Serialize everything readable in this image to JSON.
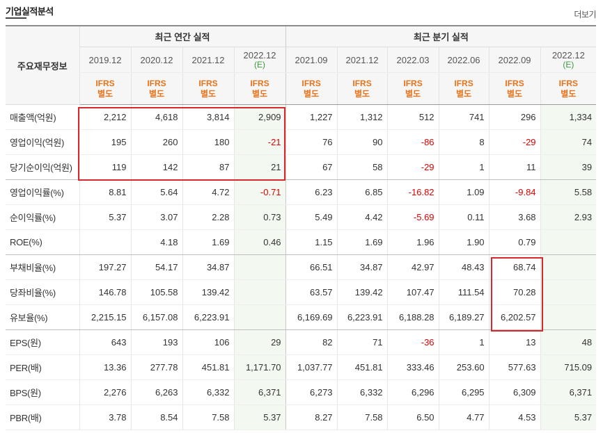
{
  "page": {
    "title": "기업실적분석",
    "more_label": "더보기"
  },
  "table": {
    "label_header": "주요재무정보",
    "group_annual": "최근 연간 실적",
    "group_quarterly": "최근 분기 실적",
    "columns": [
      {
        "date": "2019.12",
        "estimate": "",
        "basis": "IFRS",
        "scope": "별도"
      },
      {
        "date": "2020.12",
        "estimate": "",
        "basis": "IFRS",
        "scope": "별도"
      },
      {
        "date": "2021.12",
        "estimate": "",
        "basis": "IFRS",
        "scope": "별도"
      },
      {
        "date": "2022.12",
        "estimate": "(E)",
        "basis": "IFRS",
        "scope": "별도"
      },
      {
        "date": "2021.09",
        "estimate": "",
        "basis": "IFRS",
        "scope": "별도"
      },
      {
        "date": "2021.12",
        "estimate": "",
        "basis": "IFRS",
        "scope": "별도"
      },
      {
        "date": "2022.03",
        "estimate": "",
        "basis": "IFRS",
        "scope": "별도"
      },
      {
        "date": "2022.06",
        "estimate": "",
        "basis": "IFRS",
        "scope": "별도"
      },
      {
        "date": "2022.09",
        "estimate": "",
        "basis": "IFRS",
        "scope": "별도"
      },
      {
        "date": "2022.12",
        "estimate": "(E)",
        "basis": "IFRS",
        "scope": "별도"
      }
    ],
    "rows": [
      {
        "label": "매출액(억원)",
        "values": [
          "2,212",
          "4,618",
          "3,814",
          "2,909",
          "1,227",
          "1,312",
          "512",
          "741",
          "296",
          "1,334"
        ]
      },
      {
        "label": "영업이익(억원)",
        "values": [
          "195",
          "260",
          "180",
          "-21",
          "76",
          "90",
          "-86",
          "8",
          "-29",
          "74"
        ]
      },
      {
        "label": "당기순이익(억원)",
        "values": [
          "119",
          "142",
          "87",
          "21",
          "67",
          "58",
          "-29",
          "1",
          "11",
          "39"
        ]
      },
      {
        "label": "영업이익률(%)",
        "values": [
          "8.81",
          "5.64",
          "4.72",
          "-0.71",
          "6.23",
          "6.85",
          "-16.82",
          "1.09",
          "-9.84",
          "5.58"
        ]
      },
      {
        "label": "순이익률(%)",
        "values": [
          "5.37",
          "3.07",
          "2.28",
          "0.73",
          "5.49",
          "4.42",
          "-5.69",
          "0.11",
          "3.68",
          "2.93"
        ]
      },
      {
        "label": "ROE(%)",
        "values": [
          "",
          "4.18",
          "1.69",
          "0.46",
          "1.15",
          "1.69",
          "1.96",
          "1.90",
          "0.79",
          ""
        ]
      },
      {
        "label": "부채비율(%)",
        "values": [
          "197.27",
          "54.17",
          "34.87",
          "",
          "66.51",
          "34.87",
          "42.97",
          "48.43",
          "68.74",
          ""
        ]
      },
      {
        "label": "당좌비율(%)",
        "values": [
          "146.78",
          "105.58",
          "139.42",
          "",
          "63.57",
          "139.42",
          "107.47",
          "111.54",
          "70.28",
          ""
        ]
      },
      {
        "label": "유보율(%)",
        "values": [
          "2,215.15",
          "6,157.08",
          "6,223.91",
          "",
          "6,169.69",
          "6,223.91",
          "6,188.28",
          "6,189.27",
          "6,202.57",
          ""
        ]
      },
      {
        "label": "EPS(원)",
        "values": [
          "643",
          "193",
          "106",
          "29",
          "82",
          "71",
          "-36",
          "1",
          "13",
          "48"
        ]
      },
      {
        "label": "PER(배)",
        "values": [
          "13.36",
          "277.78",
          "451.81",
          "1,171.70",
          "1,037.77",
          "451.81",
          "333.46",
          "253.60",
          "577.63",
          "715.09"
        ]
      },
      {
        "label": "BPS(원)",
        "values": [
          "2,276",
          "6,263",
          "6,332",
          "6,371",
          "6,273",
          "6,332",
          "6,296",
          "6,295",
          "6,309",
          "6,371"
        ]
      },
      {
        "label": "PBR(배)",
        "values": [
          "3.78",
          "8.54",
          "7.58",
          "5.37",
          "8.27",
          "7.58",
          "6.50",
          "4.77",
          "4.53",
          "5.37"
        ]
      }
    ]
  },
  "colors": {
    "negative": "#e00000",
    "ifrs": "#e8731a",
    "estimate": "#3a9a3a",
    "highlight": "#d9282b"
  }
}
